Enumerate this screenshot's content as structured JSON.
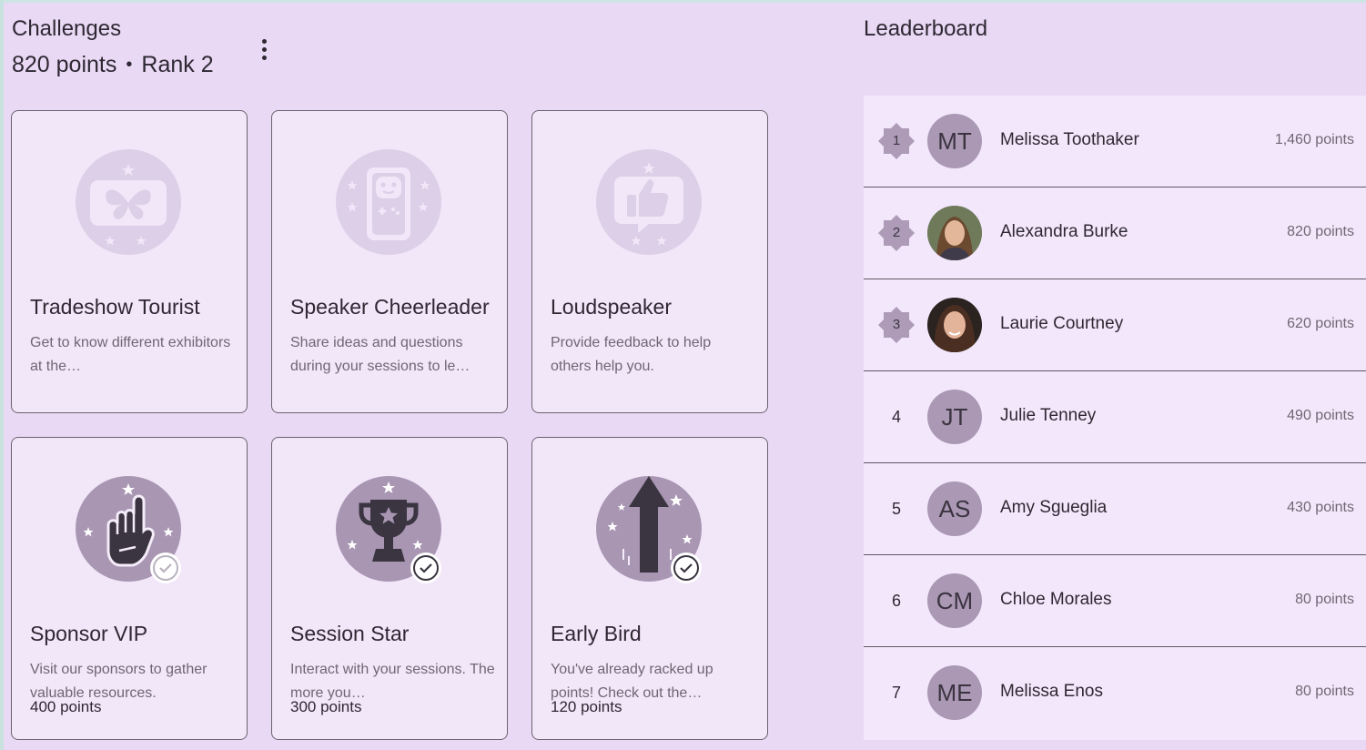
{
  "challenges": {
    "title": "Challenges",
    "points_text": "820 points",
    "separator": "•",
    "rank_text": "Rank 2",
    "menu_icon": "more-vertical-icon",
    "cards": [
      {
        "title": "Tradeshow Tourist",
        "description": "Get to know different exhibitors at the…",
        "points": "",
        "icon": "butterfly-ticket-badge-icon",
        "completed": false
      },
      {
        "title": "Speaker Cheerleader",
        "description": "Share ideas and questions during your sessions to le…",
        "points": "",
        "icon": "robot-phone-badge-icon",
        "completed": false
      },
      {
        "title": "Loudspeaker",
        "description": "Provide feedback to help others help you.",
        "points": "",
        "icon": "thumbs-up-chat-badge-icon",
        "completed": false
      },
      {
        "title": "Sponsor VIP",
        "description": "Visit our sponsors to gather valuable resources.",
        "points": "400 points",
        "icon": "foam-finger-badge-icon",
        "completed": true
      },
      {
        "title": "Session Star",
        "description": "Interact with your sessions. The more you…",
        "points": "300 points",
        "icon": "trophy-badge-icon",
        "completed": true
      },
      {
        "title": "Early Bird",
        "description": "You've already racked up points! Check out the…",
        "points": "120 points",
        "icon": "arrow-up-badge-icon",
        "completed": true
      }
    ]
  },
  "leaderboard": {
    "title": "Leaderboard",
    "entries": [
      {
        "rank": "1",
        "initials": "MT",
        "name": "Melissa Toothaker",
        "points": "1,460 points",
        "photo": false
      },
      {
        "rank": "2",
        "initials": "",
        "name": "Alexandra Burke",
        "points": "820 points",
        "photo": true
      },
      {
        "rank": "3",
        "initials": "",
        "name": "Laurie Courtney",
        "points": "620 points",
        "photo": true
      },
      {
        "rank": "4",
        "initials": "JT",
        "name": "Julie Tenney",
        "points": "490 points",
        "photo": false
      },
      {
        "rank": "5",
        "initials": "AS",
        "name": "Amy Sgueglia",
        "points": "430 points",
        "photo": false
      },
      {
        "rank": "6",
        "initials": "CM",
        "name": "Chloe Morales",
        "points": "80 points",
        "photo": false
      },
      {
        "rank": "7",
        "initials": "ME",
        "name": "Melissa Enos",
        "points": "80 points",
        "photo": false
      }
    ]
  },
  "colors": {
    "background": "#e9d9f4",
    "card": "#f2e6f9",
    "badge_locked": "#ddcfe7",
    "badge_earned": "#a996b3",
    "avatar": "#aa98b4"
  }
}
